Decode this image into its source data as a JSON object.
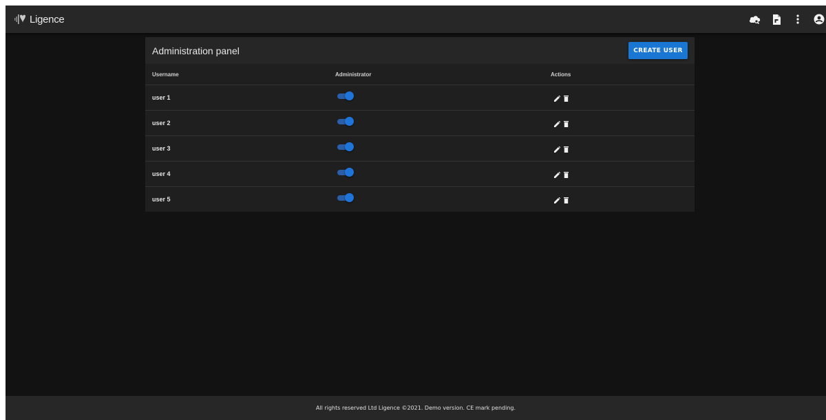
{
  "app": {
    "brand": "Ligence"
  },
  "topbar": {
    "icons": [
      "cloud-search-icon",
      "document-icon",
      "more-vert-icon",
      "account-icon"
    ]
  },
  "panel": {
    "title": "Administration panel",
    "create_button_label": "CREATE USER"
  },
  "table": {
    "headers": {
      "username": "Username",
      "administrator": "Administrator",
      "actions": "Actions"
    },
    "rows": [
      {
        "username": "user 1",
        "administrator": true
      },
      {
        "username": "user 2",
        "administrator": true
      },
      {
        "username": "user 3",
        "administrator": true
      },
      {
        "username": "user 4",
        "administrator": true
      },
      {
        "username": "user 5",
        "administrator": true
      }
    ]
  },
  "footer": {
    "text": "All rights reserved Ltd Ligence ©2021. Demo version. CE mark pending."
  },
  "colors": {
    "accent": "#1976d2",
    "background": "#121212",
    "surface": "#1f1f1f",
    "bar": "#272727"
  }
}
